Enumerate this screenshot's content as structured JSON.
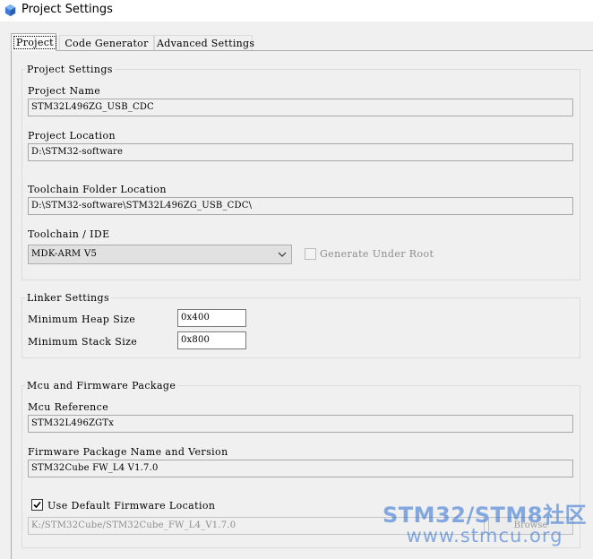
{
  "window": {
    "title": "Project Settings"
  },
  "tabs": [
    {
      "label": "Project",
      "active": true
    },
    {
      "label": "Code Generator",
      "active": false
    },
    {
      "label": "Advanced Settings",
      "active": false
    }
  ],
  "project_settings": {
    "group_title": "Project Settings",
    "project_name_label": "Project Name",
    "project_name_value": "STM32L496ZG_USB_CDC",
    "project_location_label": "Project Location",
    "project_location_value": "D:\\STM32-software",
    "toolchain_folder_label": "Toolchain Folder Location",
    "toolchain_folder_value": "D:\\STM32-software\\STM32L496ZG_USB_CDC\\",
    "toolchain_ide_label": "Toolchain / IDE",
    "toolchain_ide_value": "MDK-ARM V5",
    "generate_under_root_label": "Generate Under Root",
    "generate_under_root_checked": false
  },
  "linker_settings": {
    "group_title": "Linker Settings",
    "min_heap_label": "Minimum Heap Size",
    "min_heap_value": "0x400",
    "min_stack_label": "Minimum Stack Size",
    "min_stack_value": "0x800"
  },
  "mcu_firmware": {
    "group_title": "Mcu and Firmware Package",
    "mcu_reference_label": "Mcu Reference",
    "mcu_reference_value": "STM32L496ZGTx",
    "firmware_package_label": "Firmware Package Name and Version",
    "firmware_package_value": "STM32Cube FW_L4 V1.7.0",
    "use_default_location_label": "Use Default Firmware Location",
    "use_default_location_checked": true,
    "firmware_location_value": "K:/STM32Cube/STM32Cube_FW_L4_V1.7.0",
    "browse_label": "Browse"
  },
  "watermark": {
    "line1": "STM32/STM8社区",
    "line2": "www.stmcu.org"
  },
  "colors": {
    "window_bg": "#f0f0f0",
    "watermark": "#286ed2"
  }
}
